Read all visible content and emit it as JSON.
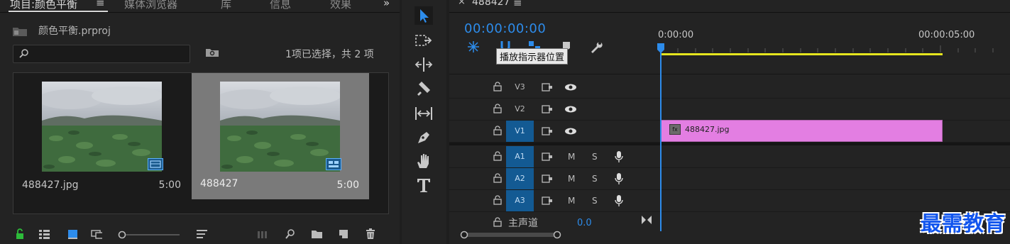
{
  "project": {
    "tabs": [
      {
        "label": "项目:颜色平衡"
      },
      {
        "label": "媒体浏览器"
      },
      {
        "label": "库"
      },
      {
        "label": "信息"
      },
      {
        "label": "效果"
      }
    ],
    "menu_glyph": "≡",
    "overflow_glyph": "»",
    "path": "颜色平衡.prproj",
    "selection_status": "1项已选择，共 2 项",
    "items": [
      {
        "name": "488427.jpg",
        "duration": "5:00",
        "selected": false,
        "badge": "still-image"
      },
      {
        "name": "488427",
        "duration": "5:00",
        "selected": true,
        "badge": "sequence"
      }
    ]
  },
  "timeline": {
    "sequence_name": "488427",
    "close_glyph": "×",
    "menu_glyph": "≡",
    "timecode": "00:00:00:00",
    "ruler": {
      "start_label": "0:00:00",
      "mid_label": "00:00:05:00"
    },
    "tooltip": "播放指示器位置",
    "video_tracks": [
      {
        "label": "V3",
        "targeted": false
      },
      {
        "label": "V2",
        "targeted": false
      },
      {
        "label": "V1",
        "targeted": true
      }
    ],
    "audio_tracks": [
      {
        "label": "A1",
        "m": "M",
        "s": "S"
      },
      {
        "label": "A2",
        "m": "M",
        "s": "S"
      },
      {
        "label": "A3",
        "m": "M",
        "s": "S"
      }
    ],
    "master": {
      "label": "主声道",
      "value": "0.0"
    },
    "clip": {
      "name": "488427.jpg",
      "fx": "fx",
      "color": "#e37ee2"
    }
  },
  "watermark": "最需教育",
  "colors": {
    "accent": "#2d8ceb",
    "target_track": "#135a93",
    "clip": "#e37ee2",
    "work_area": "#e5e51e"
  }
}
